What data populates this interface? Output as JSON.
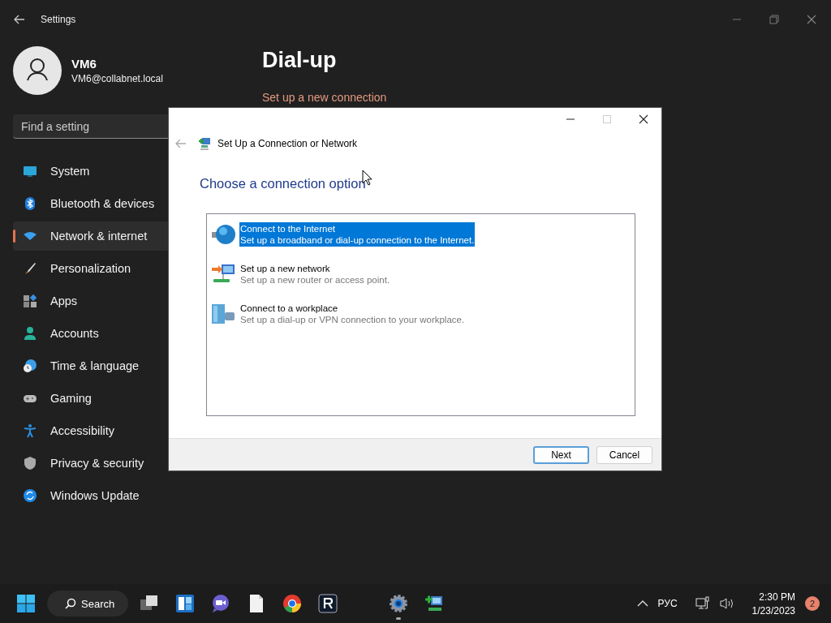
{
  "settings": {
    "title": "Settings",
    "user": {
      "name": "VM6",
      "email": "VM6@collabnet.local"
    },
    "search": {
      "placeholder": "Find a setting"
    },
    "nav": [
      {
        "kind": "system",
        "label": "System",
        "selected": false
      },
      {
        "kind": "bluetooth",
        "label": "Bluetooth & devices",
        "selected": false
      },
      {
        "kind": "network",
        "label": "Network & internet",
        "selected": true
      },
      {
        "kind": "brush",
        "label": "Personalization",
        "selected": false
      },
      {
        "kind": "apps",
        "label": "Apps",
        "selected": false
      },
      {
        "kind": "accounts",
        "label": "Accounts",
        "selected": false
      },
      {
        "kind": "time",
        "label": "Time & language",
        "selected": false
      },
      {
        "kind": "gaming",
        "label": "Gaming",
        "selected": false
      },
      {
        "kind": "accessibility",
        "label": "Accessibility",
        "selected": false
      },
      {
        "kind": "shield",
        "label": "Privacy & security",
        "selected": false
      },
      {
        "kind": "update",
        "label": "Windows Update",
        "selected": false
      }
    ],
    "page": {
      "title": "Dial-up",
      "link": "Set up a new connection"
    }
  },
  "dialog": {
    "title": "Set Up a Connection or Network",
    "heading": "Choose a connection option",
    "options": [
      {
        "kind": "internet",
        "title": "Connect to the Internet",
        "description": "Set up a broadband or dial-up connection to the Internet.",
        "selected": true
      },
      {
        "kind": "network",
        "title": "Set up a new network",
        "description": "Set up a new router or access point.",
        "selected": false
      },
      {
        "kind": "workplace",
        "title": "Connect to a workplace",
        "description": "Set up a dial-up or VPN connection to your workplace.",
        "selected": false
      }
    ],
    "buttons": [
      {
        "label": "Next",
        "default": true
      },
      {
        "label": "Cancel",
        "default": false
      }
    ]
  },
  "taskbar": {
    "search": "Search",
    "pinned": [
      {
        "kind": "taskview"
      },
      {
        "kind": "widgets"
      },
      {
        "kind": "chat"
      },
      {
        "kind": "file"
      },
      {
        "kind": "chrome"
      },
      {
        "kind": "rapp"
      }
    ],
    "open": [
      {
        "kind": "settings",
        "active": true
      },
      {
        "kind": "netwizard",
        "active": false
      }
    ],
    "tray": {
      "language": "РУС",
      "time": "2:30 PM",
      "date": "1/23/2023",
      "badge": "2"
    }
  }
}
